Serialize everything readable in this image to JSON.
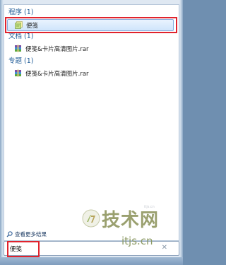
{
  "groups": [
    {
      "header": "程序 (1)",
      "items": [
        {
          "label": "便笺",
          "icon": "sticky-notes-icon",
          "selected": true
        }
      ]
    },
    {
      "header": "文档 (1)",
      "items": [
        {
          "label": "便笺&卡片高清图片.rar",
          "icon": "rar-archive-icon",
          "selected": false
        }
      ]
    },
    {
      "header": "专题 (1)",
      "items": [
        {
          "label": "便笺&卡片高清图片.rar",
          "icon": "rar-archive-icon",
          "selected": false
        }
      ]
    }
  ],
  "see_more": {
    "label": "查看更多结果",
    "icon": "search-icon"
  },
  "search": {
    "value": "便笺",
    "clear_icon": "clear-icon"
  },
  "watermark": {
    "title": "技术网",
    "domain": "itjs.cn",
    "source_label": "itjs.cn"
  },
  "colors": {
    "header_text": "#1e5a96",
    "highlight_red": "#e0232d",
    "selected_border": "#84acdd"
  }
}
